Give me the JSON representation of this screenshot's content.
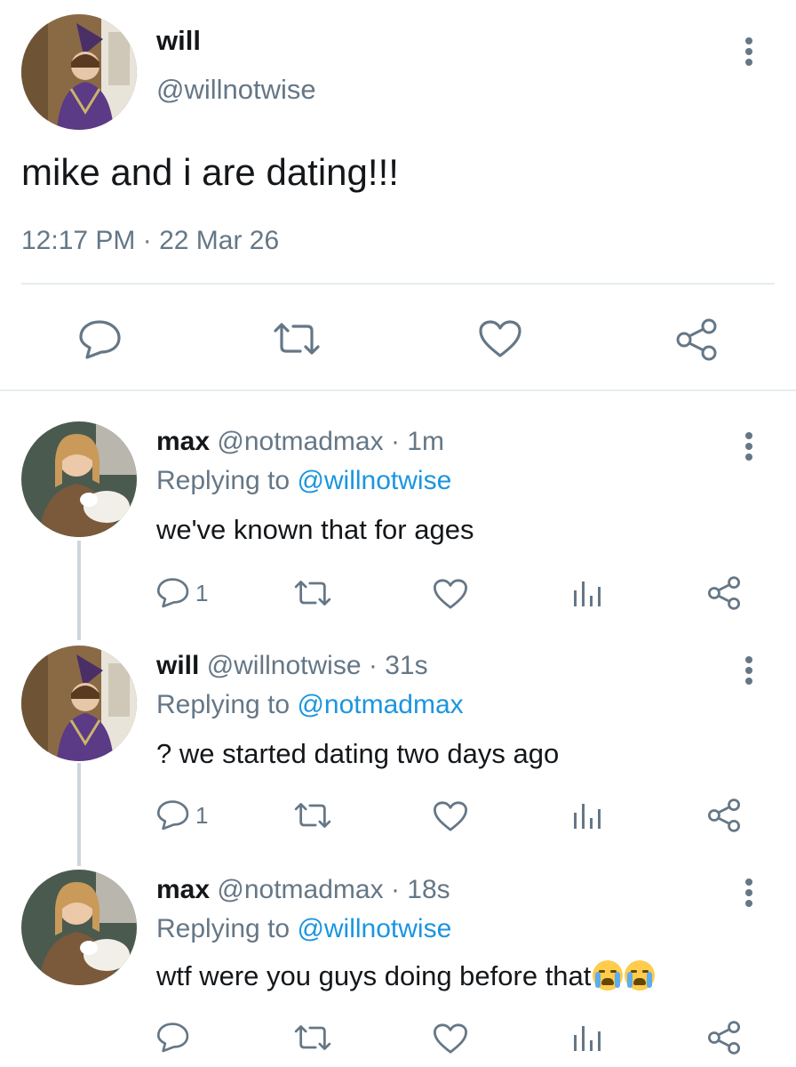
{
  "tweet": {
    "name": "will",
    "handle": "@willnotwise",
    "text": "mike and i are dating!!!",
    "timestamp": "12:17 PM · 22 Mar 26",
    "actions": [
      "reply-icon",
      "retweet-icon",
      "like-icon",
      "share-icon"
    ]
  },
  "replies": [
    {
      "name": "max",
      "handle": "@notmadmax",
      "time": "· 1m",
      "replying_label": "Replying to",
      "replying_to": "@willnotwise",
      "text": "we've known that for ages",
      "reply_count": "1"
    },
    {
      "name": "will",
      "handle": "@willnotwise",
      "time": "· 31s",
      "replying_label": "Replying to",
      "replying_to": "@notmadmax",
      "text": "? we started dating two days ago",
      "reply_count": "1"
    },
    {
      "name": "max",
      "handle": "@notmadmax",
      "time": "· 18s",
      "replying_label": "Replying to",
      "replying_to": "@willnotwise",
      "text": "wtf were you guys doing before that",
      "emojis": [
        "loudly-crying-face",
        "loudly-crying-face"
      ],
      "reply_count": ""
    }
  ],
  "colors": {
    "text": "#14171a",
    "muted": "#657786",
    "link": "#1b95e0",
    "divider": "#e6ecf0",
    "thread_line": "#ccd6dd"
  }
}
